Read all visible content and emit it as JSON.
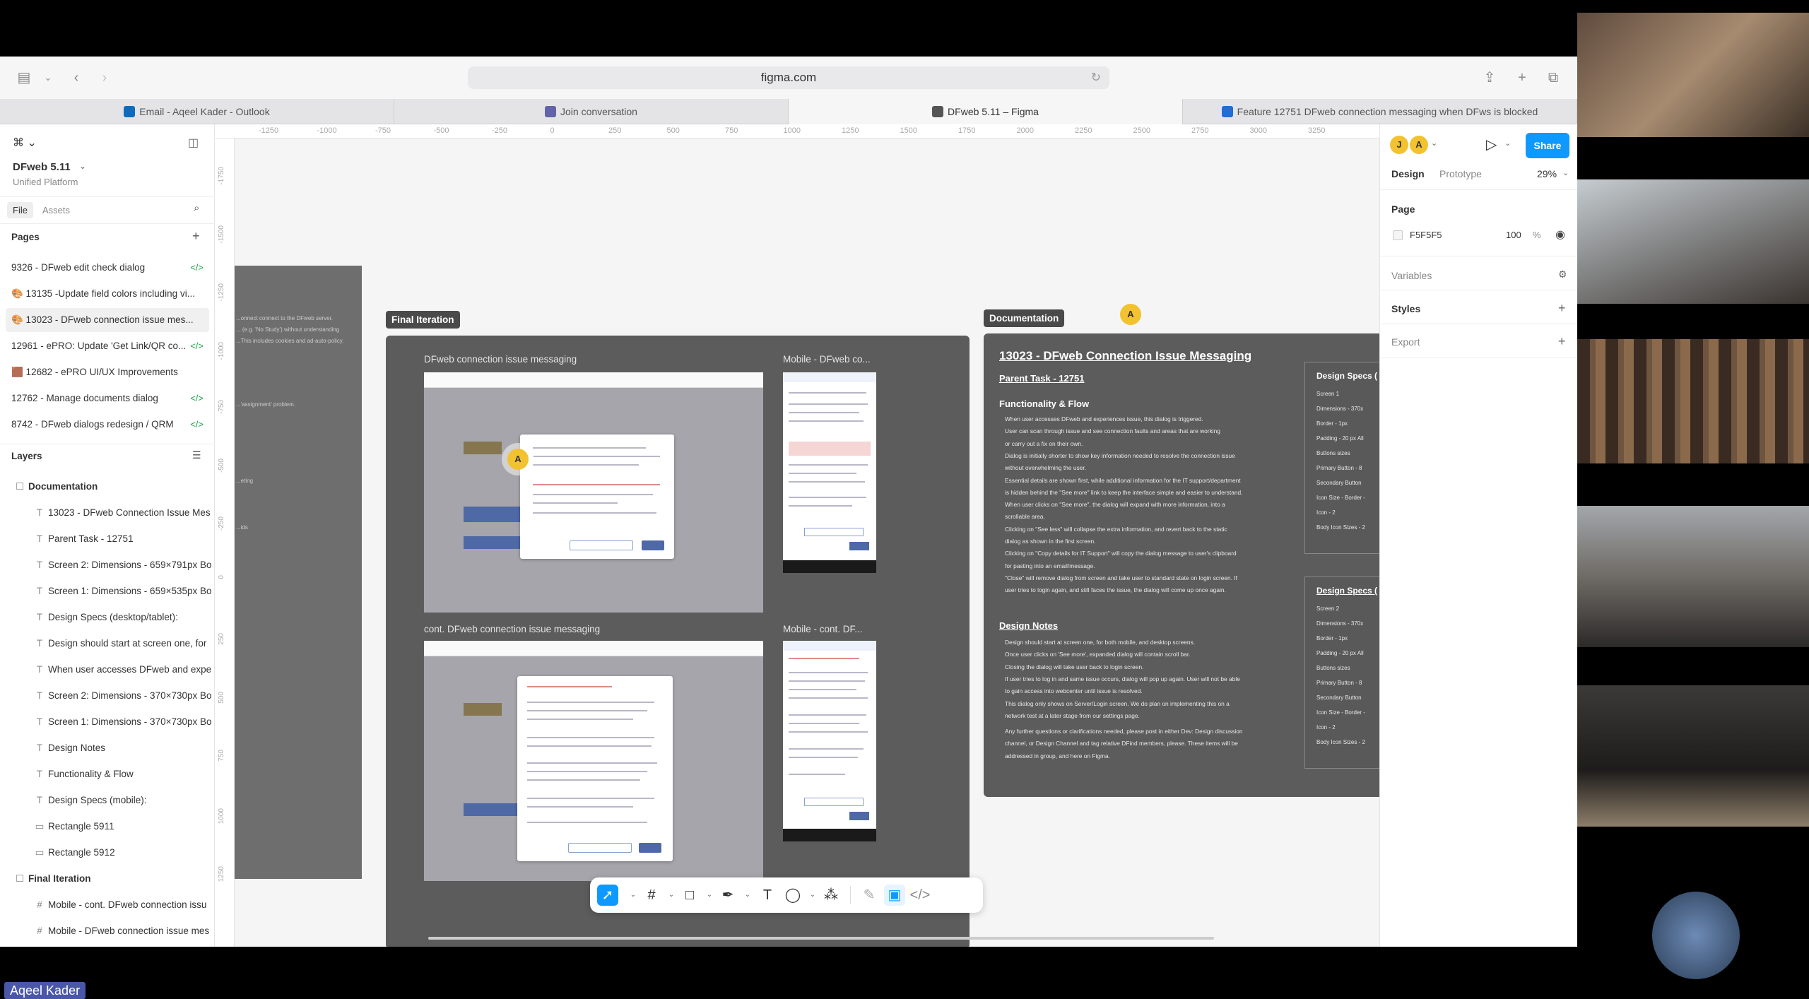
{
  "browser": {
    "url": "figma.com",
    "tabs": [
      {
        "label": "Email - Aqeel Kader - Outlook",
        "active": false,
        "color": "#0f6cbd"
      },
      {
        "label": "Join conversation",
        "active": false,
        "color": "#6264a7"
      },
      {
        "label": "DFweb 5.11 – Figma",
        "active": true,
        "color": "#555555"
      },
      {
        "label": "Feature 12751 DFweb connection messaging when DFws is blocked",
        "active": false,
        "color": "#1f6fd1"
      }
    ]
  },
  "sidebar": {
    "file_name": "DFweb 5.11",
    "team": "Unified Platform",
    "tab_file": "File",
    "tab_assets": "Assets",
    "pages_title": "Pages",
    "pages": [
      {
        "label": "9326 - DFweb edit check dialog",
        "code": "</>",
        "selected": false
      },
      {
        "label": "🎨 13135 -Update field colors including vi...",
        "code": "",
        "selected": false
      },
      {
        "label": "🎨 13023 - DFweb connection issue mes...",
        "code": "",
        "selected": true
      },
      {
        "label": "12961 - ePRO: Update 'Get Link/QR co...",
        "code": "</>",
        "selected": false
      },
      {
        "label": "🟫 12682 - ePRO UI/UX Improvements",
        "code": "",
        "selected": false
      },
      {
        "label": "12762 - Manage documents dialog",
        "code": "</>",
        "selected": false
      },
      {
        "label": "8742 - DFweb dialogs redesign / QRM",
        "code": "</>",
        "selected": false
      }
    ],
    "layers_title": "Layers",
    "layers": [
      {
        "label": "Documentation",
        "icon": "☐",
        "indent": 0,
        "bold": true
      },
      {
        "label": "13023 - DFweb Connection Issue Mes",
        "icon": "T",
        "indent": 1,
        "bold": false
      },
      {
        "label": "Parent Task - 12751",
        "icon": "T",
        "indent": 1,
        "bold": false
      },
      {
        "label": "Screen 2: Dimensions - 659×791px Bo",
        "icon": "T",
        "indent": 1,
        "bold": false
      },
      {
        "label": "Screen 1: Dimensions - 659×535px Bo",
        "icon": "T",
        "indent": 1,
        "bold": false
      },
      {
        "label": "Design Specs (desktop/tablet):",
        "icon": "T",
        "indent": 1,
        "bold": false
      },
      {
        "label": "Design should start at screen one, for",
        "icon": "T",
        "indent": 1,
        "bold": false
      },
      {
        "label": "When user accesses DFweb and expe",
        "icon": "T",
        "indent": 1,
        "bold": false
      },
      {
        "label": "Screen 2: Dimensions - 370×730px Bo",
        "icon": "T",
        "indent": 1,
        "bold": false
      },
      {
        "label": "Screen 1: Dimensions - 370×730px Bo",
        "icon": "T",
        "indent": 1,
        "bold": false
      },
      {
        "label": "Design Notes",
        "icon": "T",
        "indent": 1,
        "bold": false
      },
      {
        "label": "Functionality & Flow",
        "icon": "T",
        "indent": 1,
        "bold": false
      },
      {
        "label": "Design Specs (mobile):",
        "icon": "T",
        "indent": 1,
        "bold": false
      },
      {
        "label": "Rectangle 5911",
        "icon": "▭",
        "indent": 1,
        "bold": false
      },
      {
        "label": "Rectangle 5912",
        "icon": "▭",
        "indent": 1,
        "bold": false
      },
      {
        "label": "Final Iteration",
        "icon": "☐",
        "indent": 0,
        "bold": true
      },
      {
        "label": "Mobile - cont. DFweb connection issu",
        "icon": "#",
        "indent": 1,
        "bold": false
      },
      {
        "label": "Mobile - DFweb connection issue mes",
        "icon": "#",
        "indent": 1,
        "bold": false
      }
    ]
  },
  "ruler": {
    "top": [
      "-1250",
      "-1000",
      "-750",
      "-500",
      "-250",
      "0",
      "250",
      "500",
      "750",
      "1000",
      "1250",
      "1500",
      "1750",
      "2000",
      "2250",
      "2500",
      "2750",
      "3000",
      "3250"
    ],
    "left": [
      "-1750",
      "-1500",
      "-1250",
      "-1000",
      "-750",
      "-500",
      "-250",
      "0",
      "250",
      "500",
      "750",
      "1000",
      "1250"
    ]
  },
  "canvas": {
    "final_label": "Final Iteration",
    "doc_label": "Documentation",
    "shot1_label": "DFweb connection issue messaging",
    "shot2_label": "Mobile - DFweb co...",
    "shot3_label": "cont. DFweb connection issue messaging",
    "shot4_label": "Mobile - cont. DF...",
    "cursor_initial": "A",
    "doc": {
      "title": "13023 - DFweb Connection Issue Messaging",
      "parent": "Parent Task - 12751",
      "func_title": "Functionality & Flow",
      "func_items": [
        "When user accesses DFweb and experiences issue, this dialog is triggered.",
        "User can scan through issue and see connection faults and areas that are working",
        "or carry out a fix on their own.",
        "Dialog is initially shorter to show key information needed to resolve the connection issue",
        "without overwhelming the user.",
        "Essential details are shown first, while additional information for the IT support/department",
        "is hidden behind the \"See more\" link to keep the interface simple and easier to understand.",
        "When user clicks on \"See more\", the dialog will expand with more information, into a",
        "scrollable area.",
        "Clicking on \"See less\" will collapse the extra information, and revert back to the static",
        "dialog as shown in the first screen.",
        "Clicking on \"Copy details for IT Support\" will copy the dialog message to user's clipboard",
        "for pasting into an email/message.",
        "\"Close\" will remove dialog from screen and take user to standard state on login screen. If",
        "user tries to login again, and still faces the issue, the dialog will come up once again."
      ],
      "notes_title": "Design Notes",
      "notes_items": [
        "Design should start at screen one, for both mobile, and desktop screens.",
        "Once user clicks on 'See more', expanded dialog will contain scroll bar.",
        "Closing the dialog will take user back to login screen.",
        "If user tries to log in and same issue occurs, dialog will pop up again. User will not be able",
        "to gain access into webcenter until issue is resolved.",
        "This dialog only shows on Server/Login screen. We do plan on implementing this on a",
        "network test at a later stage from our settings page."
      ],
      "footer": [
        "Any further questions or clarifications needed, please post in either Dev: Design discussion",
        "channel, or Design Channel and tag relative DFind members, please. These items will be",
        "addressed in group, and here on Figma."
      ],
      "specs1_title": "Design Specs (",
      "specs1_items": [
        "Screen 1",
        "Dimensions - 370x",
        "Border - 1px",
        "Padding - 20 px All",
        "Buttons sizes",
        "Primary Button - 8",
        "Secondary Button",
        "Icon Size - Border -",
        "Icon - 2",
        "Body Icon Sizes - 2"
      ],
      "specs2_title": "Design Specs (",
      "specs2_items": [
        "Screen 2",
        "Dimensions - 370x",
        "Border - 1px",
        "Padding - 20 px All",
        "Buttons sizes",
        "Primary Button - 8",
        "Secondary Button",
        "Icon Size - Border -",
        "Icon - 2",
        "Body Icon Sizes - 2"
      ]
    },
    "left_frame_text": [
      "...onnect connect to the DFweb server.",
      "... (e.g. 'No Study') without understanding",
      "...This includes cookies and ad-auto-policy.",
      "...'assignment' problem.",
      "...eting",
      "...ids"
    ]
  },
  "right_panel": {
    "avatars": [
      "J",
      "A"
    ],
    "share_label": "Share",
    "tab_design": "Design",
    "tab_prototype": "Prototype",
    "zoom": "29%",
    "page_title": "Page",
    "page_color": "F5F5F5",
    "page_opacity": "100",
    "percent": "%",
    "variables": "Variables",
    "styles": "Styles",
    "export": "Export",
    "help": "?"
  },
  "meeting": {
    "name_badge": "Aqeel Kader"
  },
  "colors": {
    "accent": "#0d99ff",
    "canvas_bg": "#f5f5f5",
    "frame_dark": "#5c5c5c",
    "avatar_yellow": "#f2c230",
    "code_green": "#1aa34a"
  }
}
